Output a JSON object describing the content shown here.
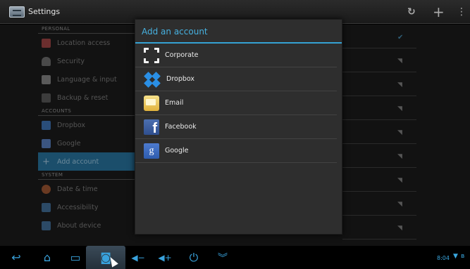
{
  "action_bar": {
    "title": "Settings",
    "icons": [
      "settings-app-icon",
      "sync-icon",
      "add-icon",
      "overflow-menu-icon"
    ]
  },
  "settings_list": {
    "sections": [
      {
        "header": "PERSONAL",
        "items": [
          {
            "label": "Location access",
            "icon": "location-icon"
          },
          {
            "label": "Security",
            "icon": "lock-icon"
          },
          {
            "label": "Language & input",
            "icon": "language-icon"
          },
          {
            "label": "Backup & reset",
            "icon": "backup-icon"
          }
        ]
      },
      {
        "header": "ACCOUNTS",
        "items": [
          {
            "label": "Dropbox",
            "icon": "dropbox-icon"
          },
          {
            "label": "Google",
            "icon": "google-icon"
          },
          {
            "label": "Add account",
            "icon": "add-icon",
            "selected": true
          }
        ]
      },
      {
        "header": "SYSTEM",
        "items": [
          {
            "label": "Date & time",
            "icon": "clock-icon"
          },
          {
            "label": "Accessibility",
            "icon": "accessibility-icon"
          },
          {
            "label": "About device",
            "icon": "info-icon"
          }
        ]
      }
    ]
  },
  "dialog": {
    "title": "Add an account",
    "accounts": [
      {
        "label": "Corporate",
        "icon": "corporate-icon"
      },
      {
        "label": "Dropbox",
        "icon": "dropbox-icon"
      },
      {
        "label": "Email",
        "icon": "email-icon"
      },
      {
        "label": "Facebook",
        "icon": "facebook-icon"
      },
      {
        "label": "Google",
        "icon": "google-icon"
      }
    ]
  },
  "nav_bar": {
    "buttons": [
      "back-icon",
      "home-icon",
      "recent-apps-icon",
      "screenshot-icon",
      "volume-down-icon",
      "volume-up-icon",
      "power-icon",
      "menu-icon"
    ],
    "clock": "8:04",
    "status_icons": [
      "wifi-icon",
      "bluetooth-icon"
    ]
  },
  "colors": {
    "accent": "#35a2d3",
    "dialog_bg": "#2e2e2e",
    "selected_item_bg": "#1b4e6b"
  }
}
